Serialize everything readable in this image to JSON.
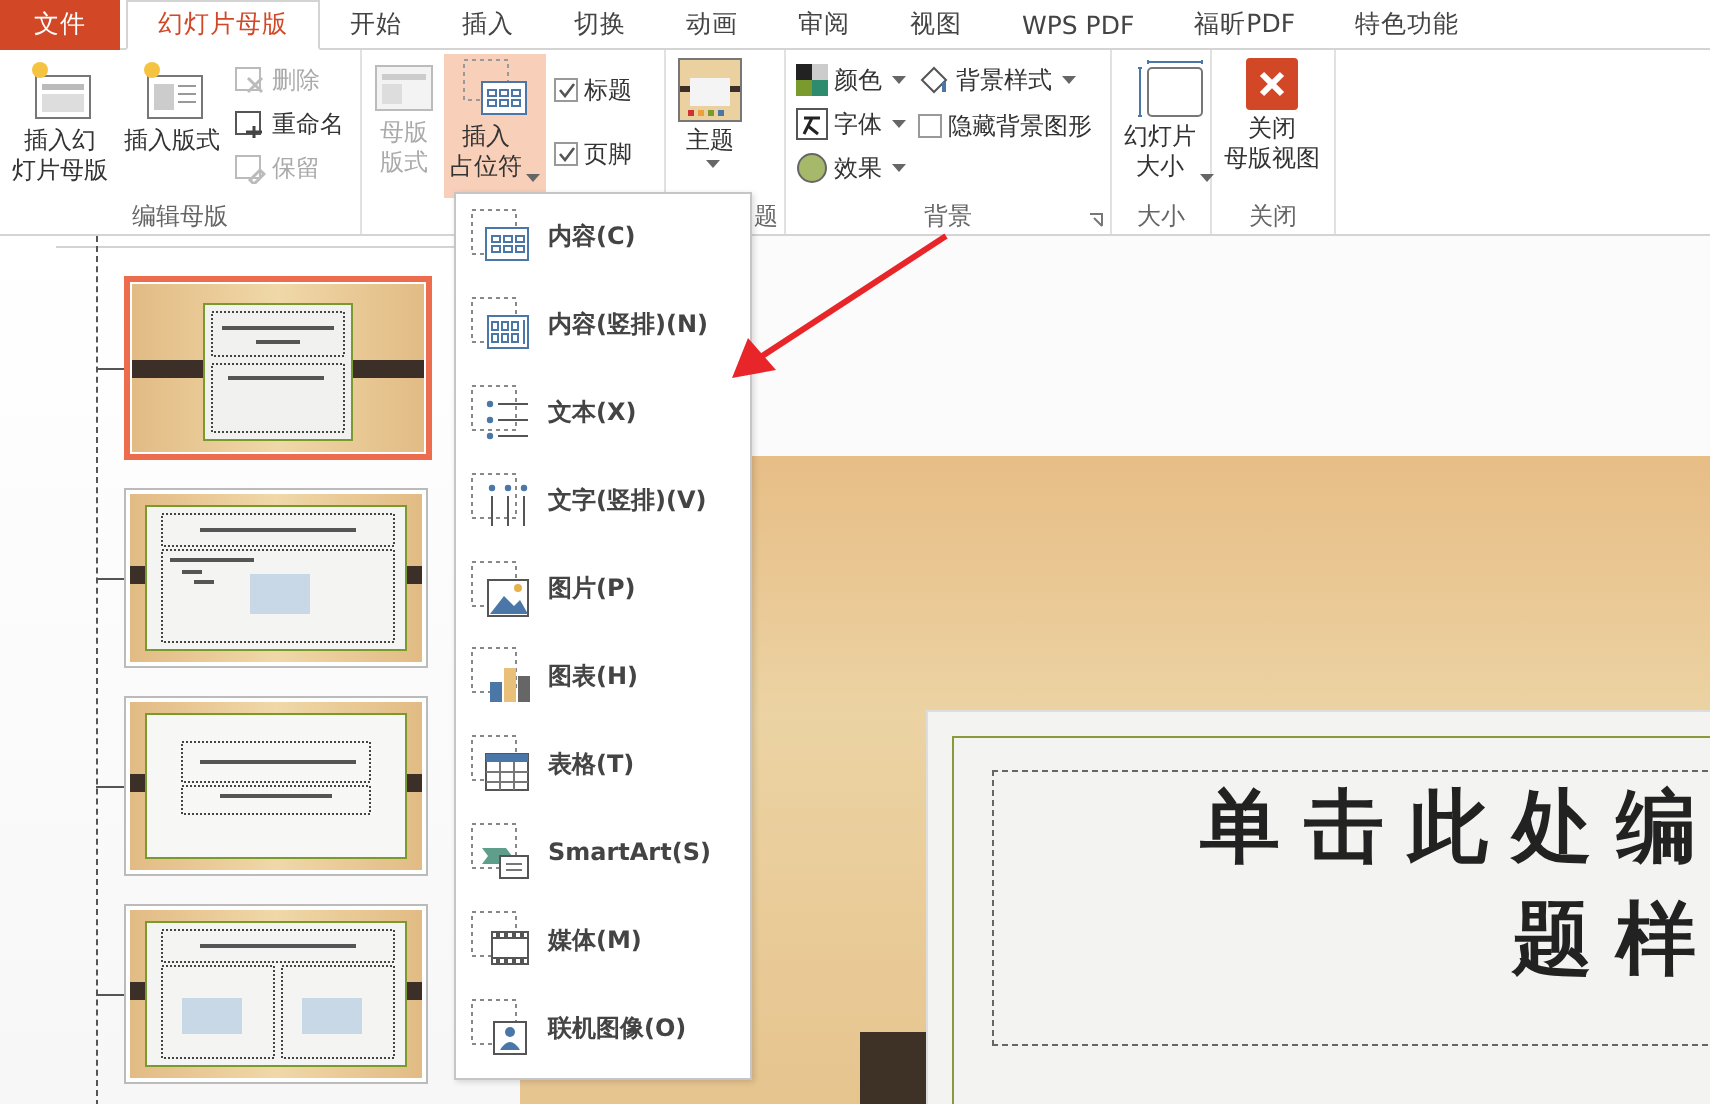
{
  "tabs": [
    {
      "label": "文件",
      "kind": "file",
      "selected": false
    },
    {
      "label": "幻灯片母版",
      "kind": "tab",
      "selected": true
    },
    {
      "label": "开始",
      "kind": "tab",
      "selected": false
    },
    {
      "label": "插入",
      "kind": "tab",
      "selected": false
    },
    {
      "label": "切换",
      "kind": "tab",
      "selected": false
    },
    {
      "label": "动画",
      "kind": "tab",
      "selected": false
    },
    {
      "label": "审阅",
      "kind": "tab",
      "selected": false
    },
    {
      "label": "视图",
      "kind": "tab",
      "selected": false
    },
    {
      "label": "WPS PDF",
      "kind": "tab",
      "selected": false
    },
    {
      "label": "福昕PDF",
      "kind": "tab",
      "selected": false
    },
    {
      "label": "特色功能",
      "kind": "tab",
      "selected": false
    }
  ],
  "ribbon": {
    "edit_master": {
      "label": "编辑母版",
      "insert_master": [
        "插入幻",
        "灯片母版"
      ],
      "insert_layout": "插入版式",
      "small_buttons": [
        {
          "label": "删除",
          "disabled": true
        },
        {
          "label": "重命名",
          "disabled": false
        },
        {
          "label": "保留",
          "disabled": true
        }
      ]
    },
    "layout": {
      "master_layout": {
        "label": [
          "母版",
          "版式"
        ],
        "disabled": true
      },
      "insert_placeholder": {
        "label": [
          "插入",
          "占位符"
        ],
        "expanded": true
      },
      "checkboxes": [
        {
          "label": "标题",
          "checked": true
        },
        {
          "label": "页脚",
          "checked": true
        }
      ]
    },
    "theme": {
      "button": "主题",
      "label": "题"
    },
    "background": {
      "label": "背景",
      "menus": [
        {
          "label": "颜色",
          "kind": "colors"
        },
        {
          "label": "字体",
          "kind": "fonts"
        },
        {
          "label": "效果",
          "kind": "effects"
        }
      ],
      "background_styles": "背景样式",
      "hide_graphics": {
        "label": "隐藏背景图形",
        "checked": false
      }
    },
    "size": {
      "label": "大小",
      "button": [
        "幻灯片",
        "大小"
      ]
    },
    "close": {
      "label": "关闭",
      "button": [
        "关闭",
        "母版视图"
      ]
    }
  },
  "placeholder_menu": [
    {
      "label": "内容(C)",
      "kind": "content"
    },
    {
      "label": "内容(竖排)(N)",
      "kind": "content-vertical"
    },
    {
      "label": "文本(X)",
      "kind": "text"
    },
    {
      "label": "文字(竖排)(V)",
      "kind": "text-vertical"
    },
    {
      "label": "图片(P)",
      "kind": "picture"
    },
    {
      "label": "图表(H)",
      "kind": "chart"
    },
    {
      "label": "表格(T)",
      "kind": "table"
    },
    {
      "label": "SmartArt(S)",
      "kind": "smartart"
    },
    {
      "label": "媒体(M)",
      "kind": "media"
    },
    {
      "label": "联机图像(O)",
      "kind": "online-picture"
    }
  ],
  "thumbnails": [
    {
      "kind": "title",
      "selected": true
    },
    {
      "kind": "content",
      "selected": false
    },
    {
      "kind": "section",
      "selected": false
    },
    {
      "kind": "two-content",
      "selected": false
    }
  ],
  "slide": {
    "title_lines": [
      "单击此处编",
      "题样"
    ]
  }
}
